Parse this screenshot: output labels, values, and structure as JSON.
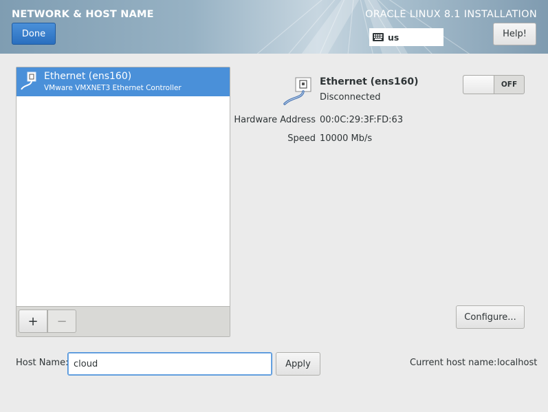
{
  "header": {
    "title": "NETWORK & HOST NAME",
    "product": "ORACLE LINUX 8.1 INSTALLATION",
    "done_label": "Done",
    "help_label": "Help!",
    "keyboard_layout": "us"
  },
  "device_list": {
    "items": [
      {
        "name": "Ethernet (ens160)",
        "description": "VMware VMXNET3 Ethernet Controller",
        "selected": true
      }
    ],
    "add_label": "+",
    "remove_label": "−"
  },
  "details": {
    "name": "Ethernet (ens160)",
    "status": "Disconnected",
    "toggle_state": "OFF",
    "hardware_address_label": "Hardware Address",
    "hardware_address": "00:0C:29:3F:FD:63",
    "speed_label": "Speed",
    "speed": "10000 Mb/s",
    "configure_label": "Configure..."
  },
  "hostname": {
    "label": "Host Name:",
    "value": "cloud",
    "apply_label": "Apply",
    "current_label": "Current host name:",
    "current_value": "localhost"
  },
  "colors": {
    "accent": "#4a90d9",
    "background": "#ebebeb"
  }
}
